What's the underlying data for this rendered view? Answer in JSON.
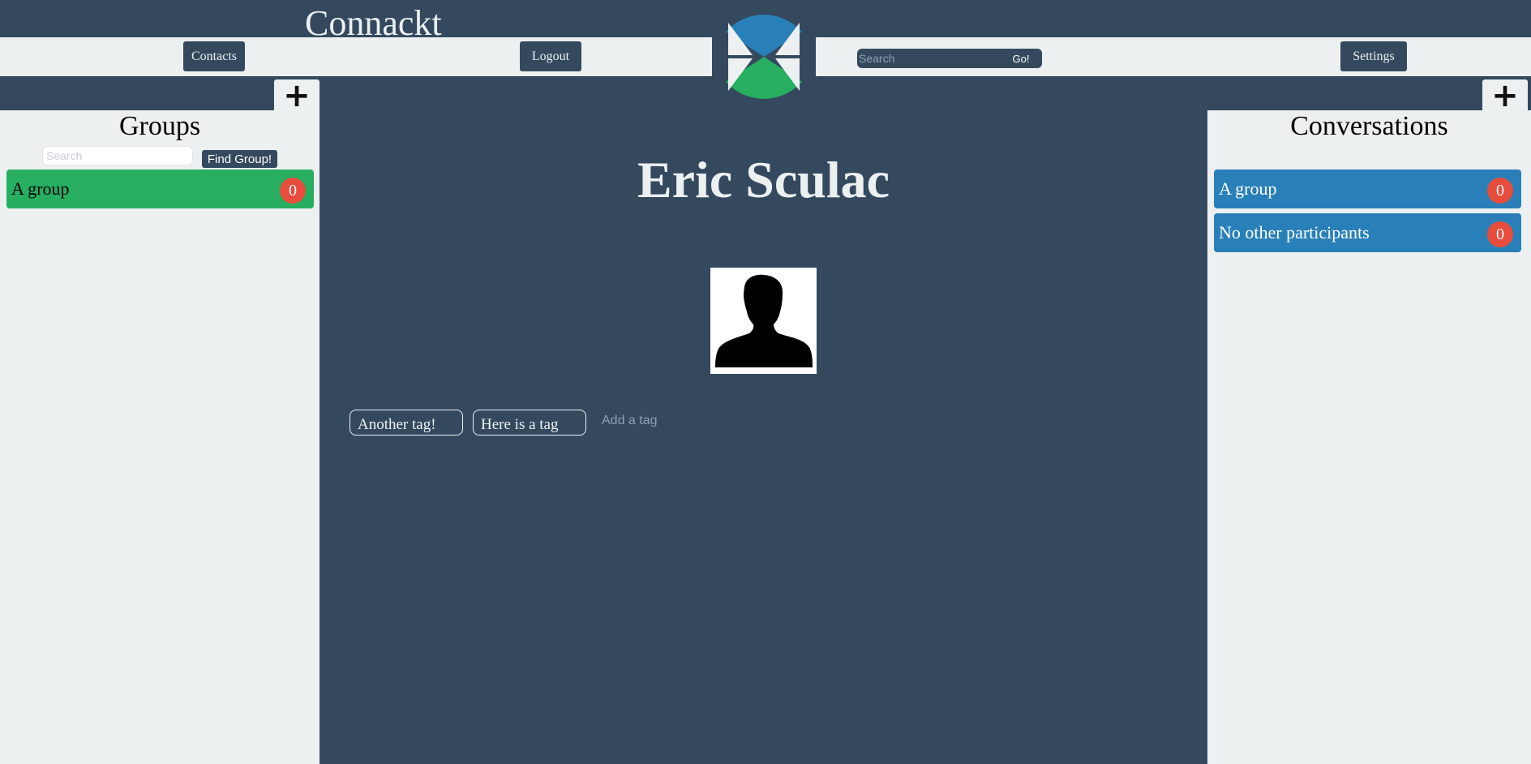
{
  "app": {
    "title": "Connackt"
  },
  "nav": {
    "contacts_label": "Contacts",
    "logout_label": "Logout",
    "search_placeholder": "Search",
    "search_go_label": "Go!",
    "settings_label": "Settings"
  },
  "groups_panel": {
    "title": "Groups",
    "add_icon": "plus-icon",
    "search_placeholder": "Search",
    "find_button_label": "Find Group!",
    "items": [
      {
        "name": "A group",
        "count": "0"
      }
    ]
  },
  "conversations_panel": {
    "title": "Conversations",
    "add_icon": "plus-icon",
    "items": [
      {
        "name": "A group",
        "count": "0"
      },
      {
        "name": "No other participants",
        "count": "0"
      }
    ]
  },
  "profile": {
    "name": "Eric Sculac",
    "avatar_icon": "person-silhouette-icon",
    "tags": [
      "Another tag!",
      "Here is a tag"
    ],
    "add_tag_placeholder": "Add a tag"
  },
  "colors": {
    "background": "#34495e",
    "panel": "#ecf0f1",
    "group_item": "#27ae60",
    "conversation_item": "#2980b9",
    "badge": "#e74c3c",
    "logo_top": "#2980b9",
    "logo_bottom": "#27ae60"
  }
}
